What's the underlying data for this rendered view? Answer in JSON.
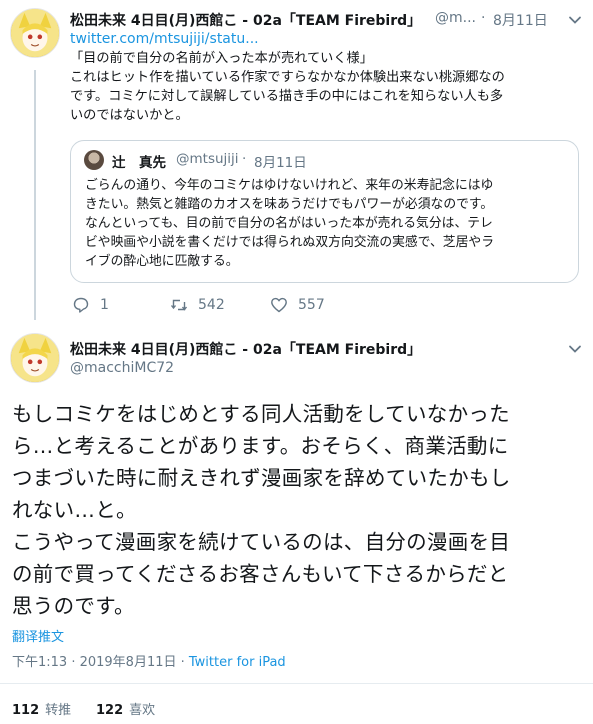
{
  "first_tweet": {
    "display_name": "松田未来 4日目(月)西館こ - 02a「TEAM Firebird」",
    "handle_truncated": "@m...",
    "dot": "·",
    "date": "8月11日",
    "link": "twitter.com/mtsujiji/statu...",
    "text_lines": [
      "「目の前で自分の名前が入った本が売れていく様」",
      "これはヒット作を描いている作家ですらなかなか体験出来ない桃源郷なの",
      "です。コミケに対して誤解している描き手の中にはこれを知らない人も多",
      "いのではないかと。"
    ],
    "quote": {
      "name": "辻　真先",
      "handle": "@mtsujiji",
      "dot": "·",
      "date": "8月11日",
      "text_lines": [
        "ごらんの通り、今年のコミケはゆけないけれど、来年の米寿記念にはゆ",
        "きたい。熱気と雑踏のカオスを味あうだけでもパワーが必須なのです。",
        "なんといっても、目の前で自分の名がはいった本が売れる気分は、テレ",
        "ビや映画や小説を書くだけでは得られぬ双方向交流の実感で、芝居やラ",
        "イブの酔心地に匹敵する。"
      ]
    },
    "actions": {
      "reply_count": "1",
      "retweet_count": "542",
      "like_count": "557"
    }
  },
  "main_tweet": {
    "display_name": "松田未来 4日目(月)西館こ - 02a「TEAM Firebird」",
    "handle": "@macchiMC72",
    "text_lines": [
      "もしコミケをはじめとする同人活動をしていなかった",
      "ら…と考えることがあります。おそらく、商業活動に",
      "つまづいた時に耐えきれず漫画家を辞めていたかもし",
      "れない…と。",
      "こうやって漫画家を続けているのは、自分の漫画を目",
      "の前で買ってくださるお客さんもいて下さるからだと",
      "思うのです。"
    ],
    "translate_label": "翻译推文",
    "timestamp": "下午1:13 · 2019年8月11日 · ",
    "source": "Twitter for iPad",
    "retweets_count": "112",
    "retweets_label": "转推",
    "likes_count": "122",
    "likes_label": "喜欢"
  },
  "icons": {
    "chevron": "chevron-down-icon",
    "reply": "reply-icon",
    "retweet": "retweet-icon",
    "like": "heart-icon"
  },
  "colors": {
    "link_blue": "#1b95e0",
    "muted_gray": "#657786",
    "border": "#ccd6dd"
  }
}
